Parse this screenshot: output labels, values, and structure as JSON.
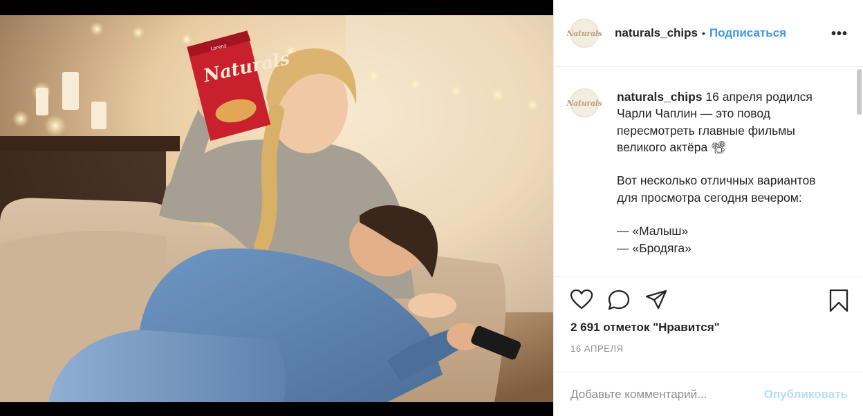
{
  "post": {
    "image_alt": "Woman in grey sweater holding Naturals chips bag, man lying on sofa with remote",
    "brand_on_pack": "Naturals",
    "brand_small_on_pack": "Lorenz"
  },
  "header": {
    "avatar_text": "Naturals",
    "username": "naturals_chips",
    "dot": "•",
    "follow_label": "Подписаться",
    "more_icon": "more-horizontal-icon"
  },
  "caption": {
    "avatar_text": "Naturals",
    "username": "naturals_chips",
    "text": " 16 апреля родился Чарли Чаплин — это повод пересмотреть главные фильмы великого актёра 📽\n\nВот несколько отличных вариантов для просмотра сегодня вечером:\n\n— «Малыш»\n— «Бродяга»"
  },
  "actions": {
    "like_icon": "heart-icon",
    "comment_icon": "comment-icon",
    "share_icon": "share-icon",
    "save_icon": "bookmark-icon",
    "likes_text": "2 691 отметок \"Нравится\"",
    "date_text": "16 АПРЕЛЯ"
  },
  "comment": {
    "placeholder": "Добавьте комментарий...",
    "publish_label": "Опубликовать"
  },
  "colors": {
    "link_blue": "#3897f0",
    "publish_disabled": "#b2dffc",
    "text": "#262626",
    "muted": "#8e8e8e",
    "border": "#efefef"
  }
}
